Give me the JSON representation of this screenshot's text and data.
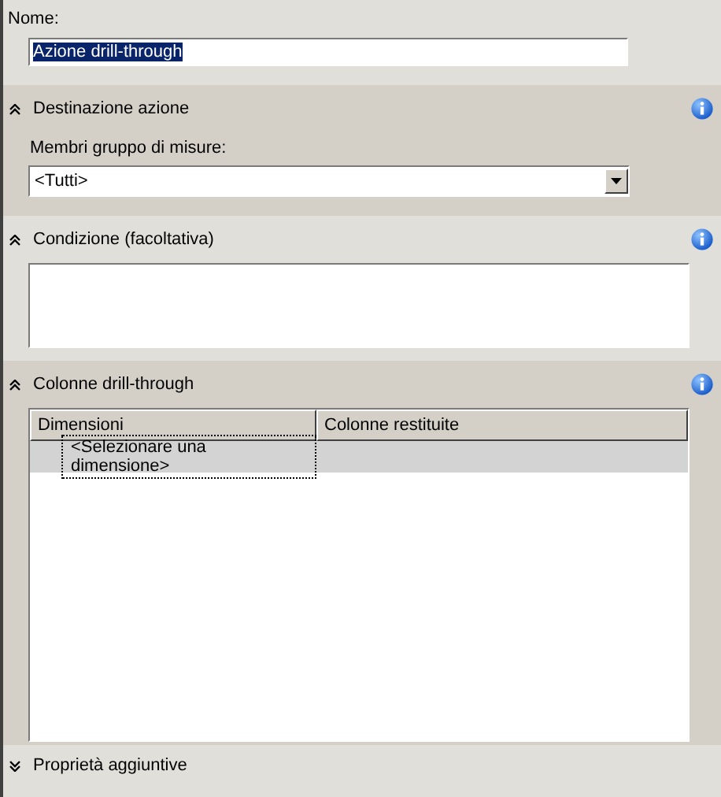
{
  "name_field": {
    "label": "Nome:",
    "value": "Azione drill-through",
    "text_selected": true
  },
  "sections": [
    {
      "kind": "target",
      "title": "Destinazione azione",
      "expanded": true,
      "info": true,
      "field_label": "Membri gruppo di misure:",
      "value": "<Tutti>"
    },
    {
      "kind": "condition",
      "title": "Condizione (facoltativa)",
      "expanded": true,
      "info": true
    },
    {
      "kind": "grid",
      "title": "Colonne drill-through",
      "expanded": true,
      "info": true,
      "columns": [
        "Dimensioni",
        "Colonne restituite"
      ],
      "rows": [
        {
          "cells": [
            "<Selezionare una dimensione>",
            ""
          ],
          "selected": true
        }
      ]
    },
    {
      "kind": "collapsed",
      "title": "Proprietà aggiuntive",
      "expanded": false,
      "info": false
    }
  ]
}
